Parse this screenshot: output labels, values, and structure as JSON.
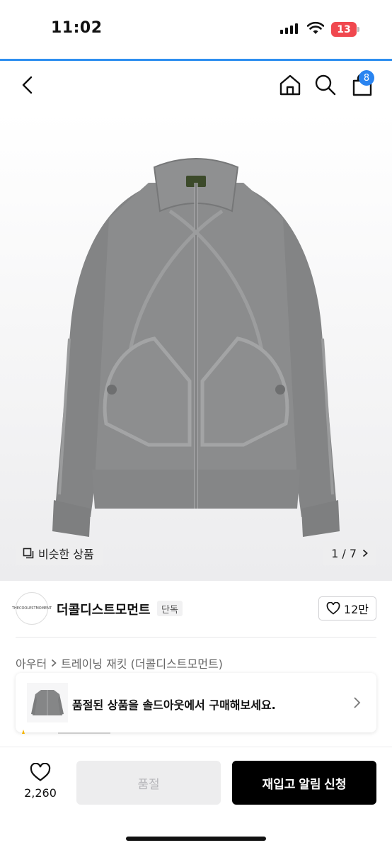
{
  "status_bar": {
    "time": "11:02",
    "battery": "13"
  },
  "nav": {
    "back_icon": "chevron-left-icon",
    "home_icon": "home-icon",
    "search_icon": "search-icon",
    "cart_icon": "shopping-bag-icon",
    "cart_count": "8"
  },
  "product_image": {
    "similar_label": "비슷한 상품",
    "page_indicator": "1 / 7"
  },
  "brand": {
    "logo_text": "THECOOLESTMOMENT",
    "name": "더콜디스트모먼트",
    "exclusive_tag": "단독",
    "like_count": "12만"
  },
  "breadcrumb": {
    "category": "아우터",
    "subcategory": "트레이닝 재킷 (더콜디스트모먼트)"
  },
  "soldout_banner": {
    "text": "품절된 상품을 솔드아웃에서 구매해보세요."
  },
  "bottom_bar": {
    "like_count": "2,260",
    "soldout_label": "품절",
    "restock_label": "재입고 알림 신청"
  },
  "colors": {
    "accent_blue": "#2a84f0",
    "battery_red": "#f0484f",
    "cta_black": "#000000",
    "jacket_gray": "#8a8b8c"
  }
}
